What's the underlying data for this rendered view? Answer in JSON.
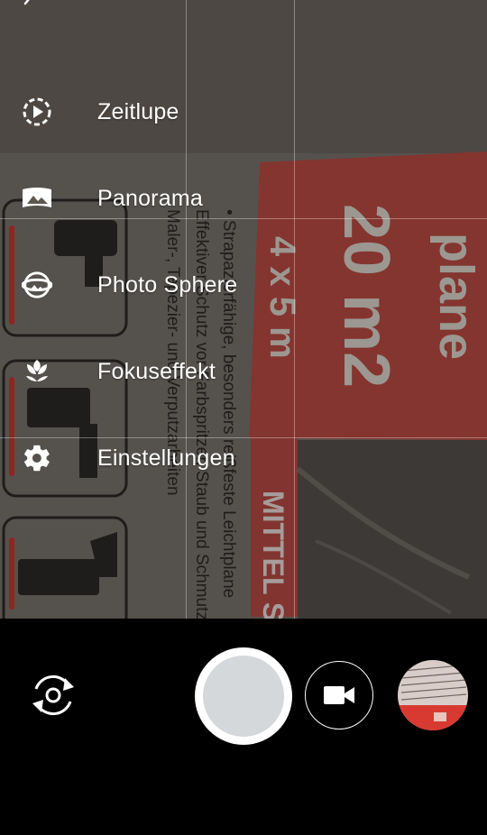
{
  "viewfinder": {
    "scene_text": {
      "brand": "plane",
      "area": "20 m2",
      "size": "4 x 5 m",
      "line1": "• Strapazierfähige, besonders reißfeste Leichtplane",
      "line2": "Effektiver Schutz vor Farbspritzer, Staub und Schmutz",
      "line3": "Maler-, Tapezier- und Verputzarbeiten",
      "stamp": "MITTEL STA"
    }
  },
  "mode_menu": {
    "items": [
      {
        "label": "Zeitlupe",
        "icon": "slow-motion-icon"
      },
      {
        "label": "Panorama",
        "icon": "panorama-icon"
      },
      {
        "label": "Photo Sphere",
        "icon": "photo-sphere-icon"
      },
      {
        "label": "Fokuseffekt",
        "icon": "lens-blur-icon"
      },
      {
        "label": "Einstellungen",
        "icon": "gear-icon"
      }
    ]
  },
  "controls": {
    "switch_camera_icon": "switch-camera-icon",
    "shutter_icon": "shutter-button",
    "video_icon": "video-camera-icon",
    "thumbnail": "last-photo-thumbnail"
  },
  "colors": {
    "text": "#ffffff",
    "shutter_outer": "#ffffff",
    "shutter_inner": "#d4d8db",
    "bar_background": "#000000",
    "plastic_red": "#c8332e"
  }
}
